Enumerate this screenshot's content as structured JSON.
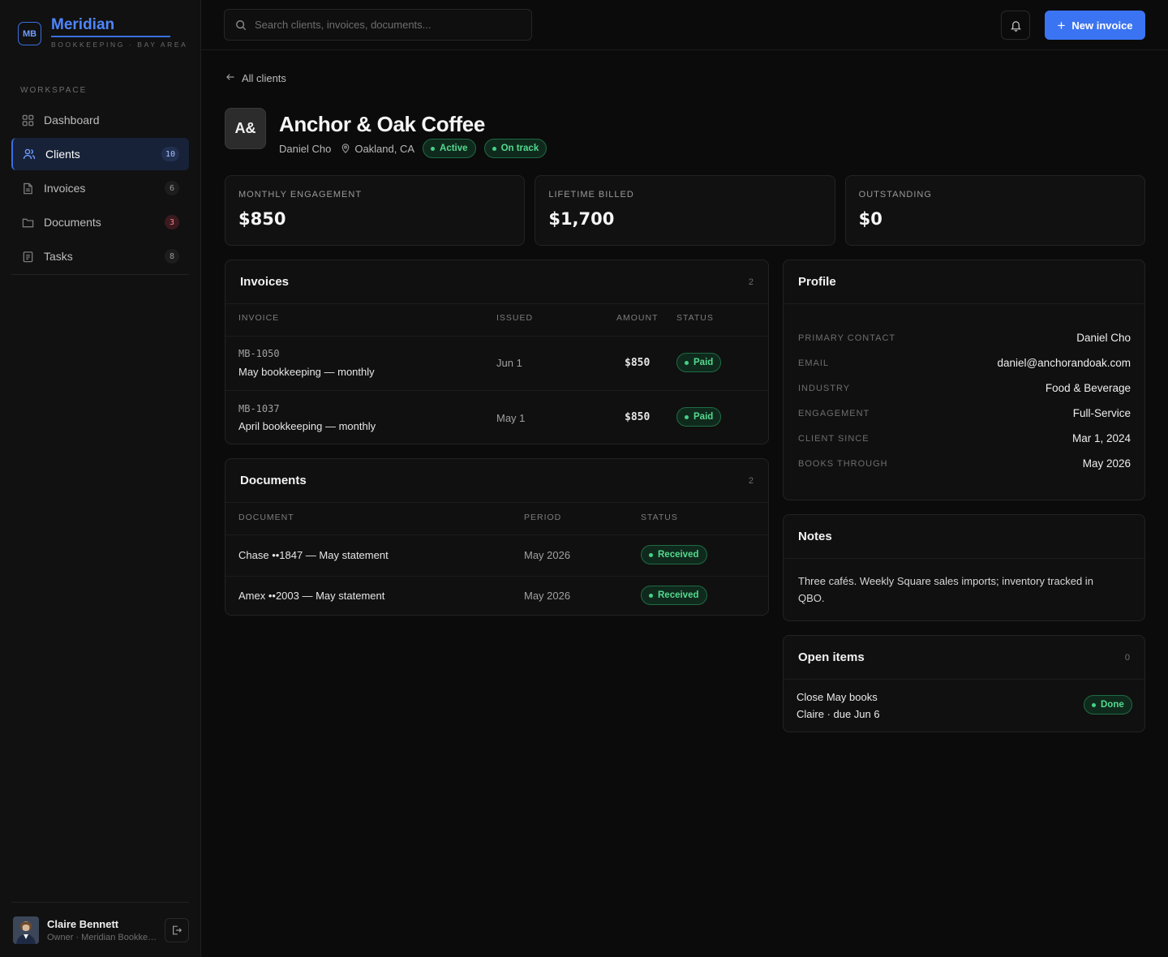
{
  "brand": {
    "mark": "MB",
    "name": "Meridian",
    "subtitle": "BOOKKEEPING · BAY AREA"
  },
  "sidebar": {
    "section_label": "WORKSPACE",
    "items": [
      {
        "label": "Dashboard",
        "icon": "grid-icon",
        "count": ""
      },
      {
        "label": "Clients",
        "icon": "users-icon",
        "count": "10",
        "active": true
      },
      {
        "label": "Invoices",
        "icon": "file-icon",
        "count": "6"
      },
      {
        "label": "Documents",
        "icon": "folder-icon",
        "count": "3",
        "count_color": "red"
      },
      {
        "label": "Tasks",
        "icon": "clipboard-icon",
        "count": "8"
      }
    ]
  },
  "user": {
    "name": "Claire Bennett",
    "role": "Owner · Meridian Bookkeeping"
  },
  "search": {
    "placeholder": "Search clients, invoices, documents..."
  },
  "header": {
    "new_invoice_label": "New invoice"
  },
  "back_link": "All clients",
  "client": {
    "initials": "A&",
    "name": "Anchor & Oak Coffee",
    "contact": "Daniel Cho",
    "location": "Oakland, CA",
    "status_badges": [
      "Active",
      "On track"
    ]
  },
  "kpis": [
    {
      "label": "MONTHLY ENGAGEMENT",
      "value": "$850"
    },
    {
      "label": "LIFETIME BILLED",
      "value": "$1,700"
    },
    {
      "label": "OUTSTANDING",
      "value": "$0"
    }
  ],
  "invoices": {
    "title": "Invoices",
    "count": "2",
    "columns": [
      "INVOICE",
      "ISSUED",
      "AMOUNT",
      "STATUS"
    ],
    "rows": [
      {
        "id": "MB-1050",
        "desc": "May bookkeeping — monthly",
        "issued": "Jun 1",
        "amount": "$850",
        "status": "Paid"
      },
      {
        "id": "MB-1037",
        "desc": "April bookkeeping — monthly",
        "issued": "May 1",
        "amount": "$850",
        "status": "Paid"
      }
    ]
  },
  "documents": {
    "title": "Documents",
    "count": "2",
    "columns": [
      "DOCUMENT",
      "PERIOD",
      "STATUS"
    ],
    "rows": [
      {
        "name": "Chase ••1847 — May statement",
        "period": "May 2026",
        "status": "Received"
      },
      {
        "name": "Amex ••2003 — May statement",
        "period": "May 2026",
        "status": "Received"
      }
    ]
  },
  "profile": {
    "title": "Profile",
    "fields": [
      {
        "key": "PRIMARY CONTACT",
        "value": "Daniel Cho"
      },
      {
        "key": "EMAIL",
        "value": "daniel@anchorandoak.com"
      },
      {
        "key": "INDUSTRY",
        "value": "Food & Beverage"
      },
      {
        "key": "ENGAGEMENT",
        "value": "Full-Service"
      },
      {
        "key": "CLIENT SINCE",
        "value": "Mar 1, 2024"
      },
      {
        "key": "BOOKS THROUGH",
        "value": "May 2026"
      }
    ]
  },
  "notes": {
    "title": "Notes",
    "text": "Three cafés. Weekly Square sales imports; inventory tracked in QBO."
  },
  "open_items": {
    "title": "Open items",
    "count": "0",
    "items": [
      {
        "title": "Close May books",
        "meta": "Claire · due Jun 6",
        "status": "Done"
      }
    ]
  },
  "colors": {
    "accent": "#3b74f2",
    "success": "#55d98f",
    "danger": "#ff7d86",
    "background": "#0b0b0b"
  }
}
